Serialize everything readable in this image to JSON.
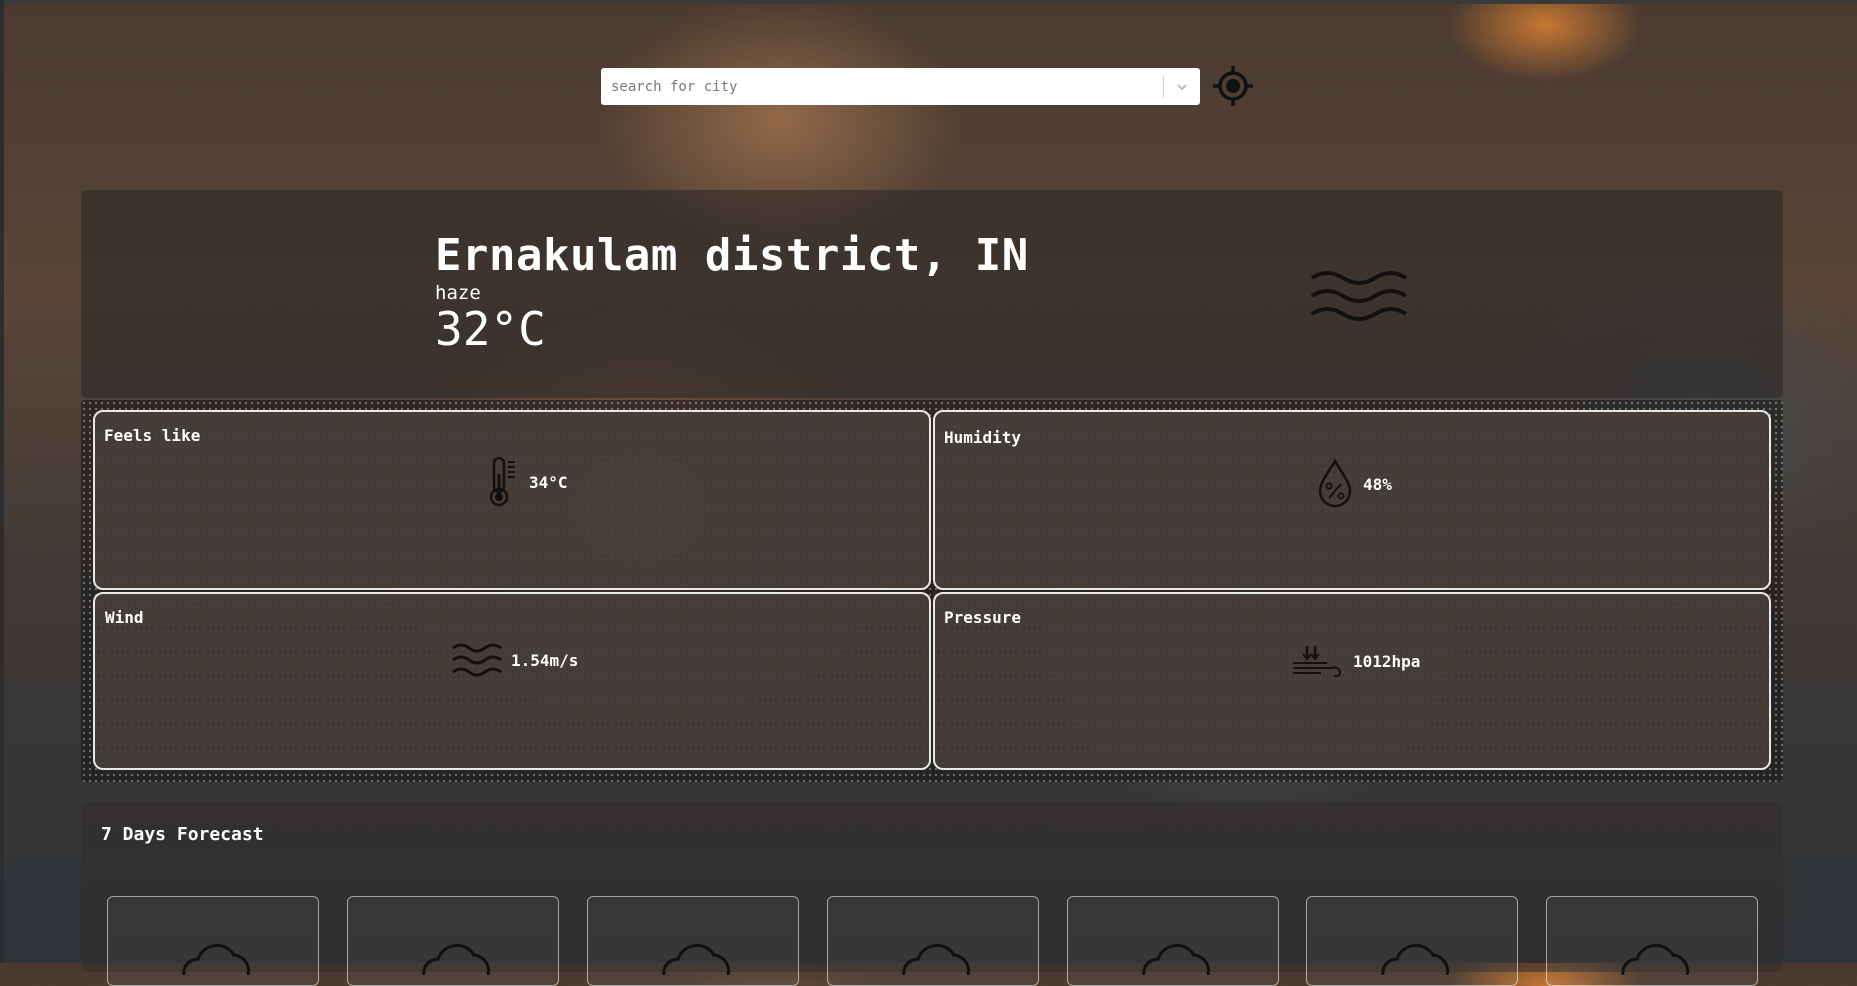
{
  "search": {
    "placeholder": "search for city"
  },
  "current": {
    "city": "Ernakulam district, IN",
    "condition": "haze",
    "temperature": "32°C",
    "icon": "haze-icon"
  },
  "details": {
    "feels_like": {
      "label": "Feels like",
      "value": "34°C",
      "icon": "thermometer-icon"
    },
    "humidity": {
      "label": "Humidity",
      "value": "48%",
      "icon": "humidity-drop-icon"
    },
    "wind": {
      "label": "Wind",
      "value": "1.54m/s",
      "icon": "wind-icon"
    },
    "pressure": {
      "label": "Pressure",
      "value": "1012hpa",
      "icon": "pressure-icon"
    }
  },
  "forecast": {
    "title": "7 Days Forecast",
    "days": [
      {
        "icon": "cloud-icon"
      },
      {
        "icon": "cloud-icon"
      },
      {
        "icon": "cloud-icon"
      },
      {
        "icon": "cloud-icon"
      },
      {
        "icon": "cloud-icon"
      },
      {
        "icon": "cloud-icon"
      },
      {
        "icon": "cloud-icon"
      }
    ]
  }
}
